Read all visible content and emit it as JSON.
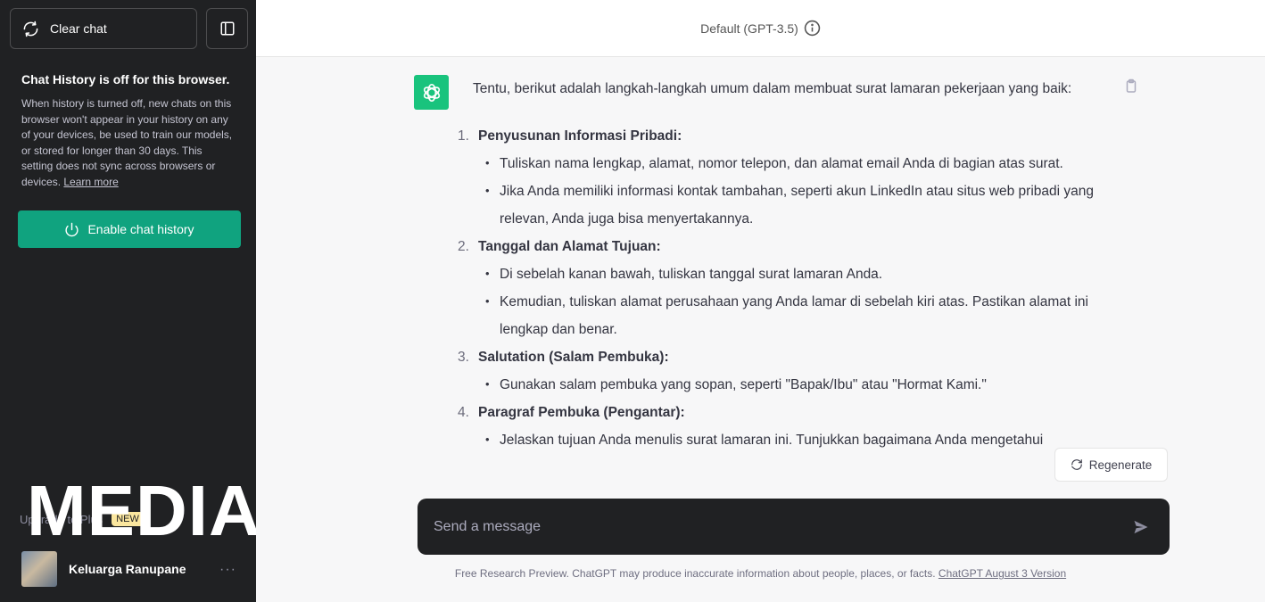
{
  "sidebar": {
    "clear_label": "Clear chat",
    "history_title": "Chat History is off for this browser.",
    "history_desc": "When history is turned off, new chats on this browser won't appear in your history on any of your devices, be used to train our models, or stored for longer than 30 days. This setting does not sync across browsers or devices.",
    "learn_more": "Learn more",
    "enable_label": "Enable chat history",
    "upgrade_label": "Upgrade to Plus",
    "upgrade_badge": "NEW",
    "watermark": "MEDIAS",
    "profile_name": "Keluarga Ranupane",
    "more": "···"
  },
  "header": {
    "model": "Default (GPT-3.5)"
  },
  "message": {
    "intro": "Tentu, berikut adalah langkah-langkah umum dalam membuat surat lamaran pekerjaan yang baik:",
    "items": [
      {
        "num": "1.",
        "title": "Penyusunan Informasi Pribadi:",
        "bullets": [
          "Tuliskan nama lengkap, alamat, nomor telepon, dan alamat email Anda di bagian atas surat.",
          "Jika Anda memiliki informasi kontak tambahan, seperti akun LinkedIn atau situs web pribadi yang relevan, Anda juga bisa menyertakannya."
        ]
      },
      {
        "num": "2.",
        "title": "Tanggal dan Alamat Tujuan:",
        "bullets": [
          "Di sebelah kanan bawah, tuliskan tanggal surat lamaran Anda.",
          "Kemudian, tuliskan alamat perusahaan yang Anda lamar di sebelah kiri atas. Pastikan alamat ini lengkap dan benar."
        ]
      },
      {
        "num": "3.",
        "title": "Salutation (Salam Pembuka):",
        "bullets": [
          "Gunakan salam pembuka yang sopan, seperti \"Bapak/Ibu\" atau \"Hormat Kami.\""
        ]
      },
      {
        "num": "4.",
        "title": "Paragraf Pembuka (Pengantar):",
        "bullets": [
          "Jelaskan tujuan Anda menulis surat lamaran ini. Tunjukkan bagaimana Anda mengetahui"
        ]
      }
    ]
  },
  "regenerate_label": "Regenerate",
  "input": {
    "placeholder": "Send a message"
  },
  "footer": {
    "text": "Free Research Preview. ChatGPT may produce inaccurate information about people, places, or facts. ",
    "version": "ChatGPT August 3 Version"
  },
  "colors": {
    "accent": "#10a37f",
    "sidebar": "#202123",
    "avatar": "#19c37d"
  }
}
